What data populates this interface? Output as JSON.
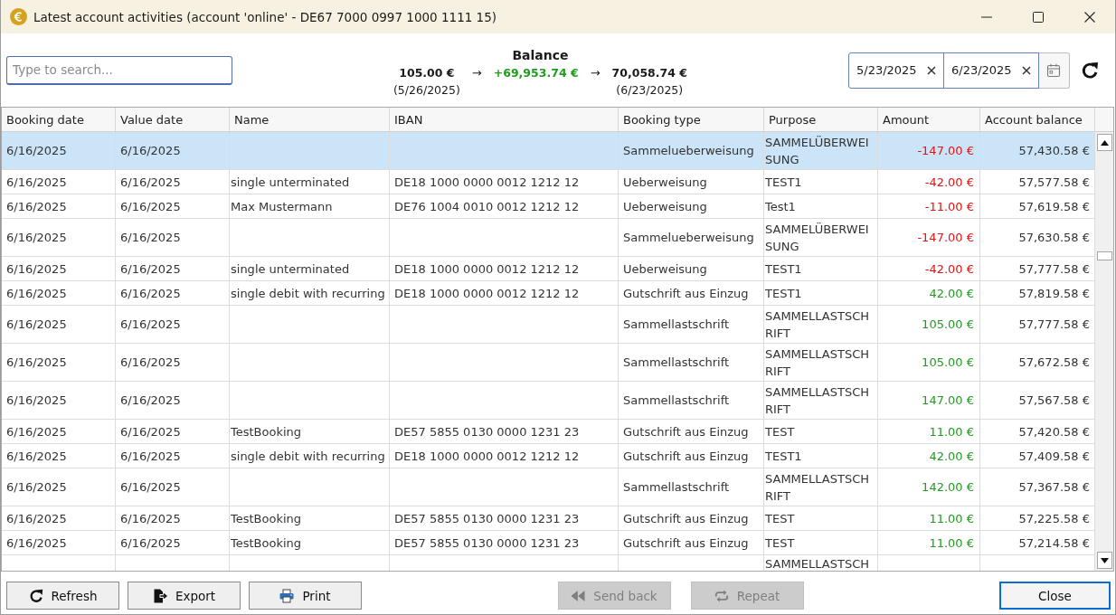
{
  "window": {
    "title": "Latest account activities (account 'online' - DE67 7000 0997 1000 1111 15)"
  },
  "search": {
    "placeholder": "Type to search..."
  },
  "balance": {
    "title": "Balance",
    "opening": {
      "amount": "105.00 €",
      "date": "(5/26/2025)"
    },
    "change": {
      "amount": "+69,953.74 €",
      "kind": "credit"
    },
    "closing": {
      "amount": "70,058.74 €",
      "date": "(6/23/2025)"
    },
    "arrows": [
      "→",
      "→"
    ]
  },
  "date_range": {
    "from": "5/23/2025",
    "to": "6/23/2025"
  },
  "table": {
    "columns": [
      "Booking date",
      "Value date",
      "Name",
      "IBAN",
      "Booking type",
      "Purpose",
      "Amount",
      "Account balance"
    ],
    "rows": [
      {
        "booking_date": "6/16/2025",
        "value_date": "6/16/2025",
        "booking_type": "Sammelueberweisung",
        "purpose": "SAMMELÜBERWEISUNG",
        "amount": "-147.00 €",
        "balance": "57,430.58 €",
        "kind": "debit",
        "selected": true
      },
      {
        "booking_date": "6/16/2025",
        "value_date": "6/16/2025",
        "name": "single unterminated",
        "iban": "DE18 1000 0000 0012 1212 12",
        "booking_type": "Ueberweisung",
        "purpose": "TEST1",
        "amount": "-42.00 €",
        "balance": "57,577.58 €",
        "kind": "debit",
        "selected": false
      },
      {
        "booking_date": "6/16/2025",
        "value_date": "6/16/2025",
        "name": "Max Mustermann",
        "iban": "DE76 1004 0010 0012 1212 12",
        "booking_type": "Ueberweisung",
        "purpose": "Test1",
        "amount": "-11.00 €",
        "balance": "57,619.58 €",
        "kind": "debit",
        "selected": false
      },
      {
        "booking_date": "6/16/2025",
        "value_date": "6/16/2025",
        "booking_type": "Sammelueberweisung",
        "purpose": "SAMMELÜBERWEISUNG",
        "amount": "-147.00 €",
        "balance": "57,630.58 €",
        "kind": "debit",
        "selected": false
      },
      {
        "booking_date": "6/16/2025",
        "value_date": "6/16/2025",
        "name": "single unterminated",
        "iban": "DE18 1000 0000 0012 1212 12",
        "booking_type": "Ueberweisung",
        "purpose": "TEST1",
        "amount": "-42.00 €",
        "balance": "57,777.58 €",
        "kind": "debit",
        "selected": false
      },
      {
        "booking_date": "6/16/2025",
        "value_date": "6/16/2025",
        "name": "single debit with recurring",
        "iban": "DE18 1000 0000 0012 1212 12",
        "booking_type": "Gutschrift aus Einzug",
        "purpose": "TEST1",
        "amount": "42.00 €",
        "balance": "57,819.58 €",
        "kind": "credit",
        "selected": false
      },
      {
        "booking_date": "6/16/2025",
        "value_date": "6/16/2025",
        "booking_type": "Sammellastschrift",
        "purpose": "SAMMELLASTSCHRIFT",
        "amount": "105.00 €",
        "balance": "57,777.58 €",
        "kind": "credit",
        "selected": false
      },
      {
        "booking_date": "6/16/2025",
        "value_date": "6/16/2025",
        "booking_type": "Sammellastschrift",
        "purpose": "SAMMELLASTSCHRIFT",
        "amount": "105.00 €",
        "balance": "57,672.58 €",
        "kind": "credit",
        "selected": false
      },
      {
        "booking_date": "6/16/2025",
        "value_date": "6/16/2025",
        "booking_type": "Sammellastschrift",
        "purpose": "SAMMELLASTSCHRIFT",
        "amount": "147.00 €",
        "balance": "57,567.58 €",
        "kind": "credit",
        "selected": false
      },
      {
        "booking_date": "6/16/2025",
        "value_date": "6/16/2025",
        "name": "TestBooking",
        "iban": "DE57 5855 0130 0000 1231 23",
        "booking_type": "Gutschrift aus Einzug",
        "purpose": "TEST",
        "amount": "11.00 €",
        "balance": "57,420.58 €",
        "kind": "credit",
        "selected": false
      },
      {
        "booking_date": "6/16/2025",
        "value_date": "6/16/2025",
        "name": "single debit with recurring",
        "iban": "DE18 1000 0000 0012 1212 12",
        "booking_type": "Gutschrift aus Einzug",
        "purpose": "TEST1",
        "amount": "42.00 €",
        "balance": "57,409.58 €",
        "kind": "credit",
        "selected": false
      },
      {
        "booking_date": "6/16/2025",
        "value_date": "6/16/2025",
        "booking_type": "Sammellastschrift",
        "purpose": "SAMMELLASTSCHRIFT",
        "amount": "142.00 €",
        "balance": "57,367.58 €",
        "kind": "credit",
        "selected": false
      },
      {
        "booking_date": "6/16/2025",
        "value_date": "6/16/2025",
        "name": "TestBooking",
        "iban": "DE57 5855 0130 0000 1231 23",
        "booking_type": "Gutschrift aus Einzug",
        "purpose": "TEST",
        "amount": "11.00 €",
        "balance": "57,225.58 €",
        "kind": "credit",
        "selected": false
      },
      {
        "booking_date": "6/16/2025",
        "value_date": "6/16/2025",
        "name": "TestBooking",
        "iban": "DE57 5855 0130 0000 1231 23",
        "booking_type": "Gutschrift aus Einzug",
        "purpose": "TEST",
        "amount": "11.00 €",
        "balance": "57,214.58 €",
        "kind": "credit",
        "selected": false
      },
      {
        "purpose": "SAMMELLASTSCH",
        "selected": false
      }
    ]
  },
  "footer": {
    "left_buttons": [
      {
        "label": "Refresh",
        "kind": "refresh",
        "disabled": false,
        "default": false
      },
      {
        "label": "Export",
        "kind": "export",
        "disabled": false,
        "default": false
      },
      {
        "label": "Print",
        "kind": "print",
        "disabled": false,
        "default": false
      }
    ],
    "middle_buttons": [
      {
        "label": "Send back",
        "kind": "send_back",
        "disabled": true,
        "default": false
      },
      {
        "label": "Repeat",
        "kind": "repeat",
        "disabled": true,
        "default": false
      }
    ],
    "right_buttons": [
      {
        "label": "Close",
        "kind": "close",
        "disabled": false,
        "default": true
      }
    ]
  }
}
